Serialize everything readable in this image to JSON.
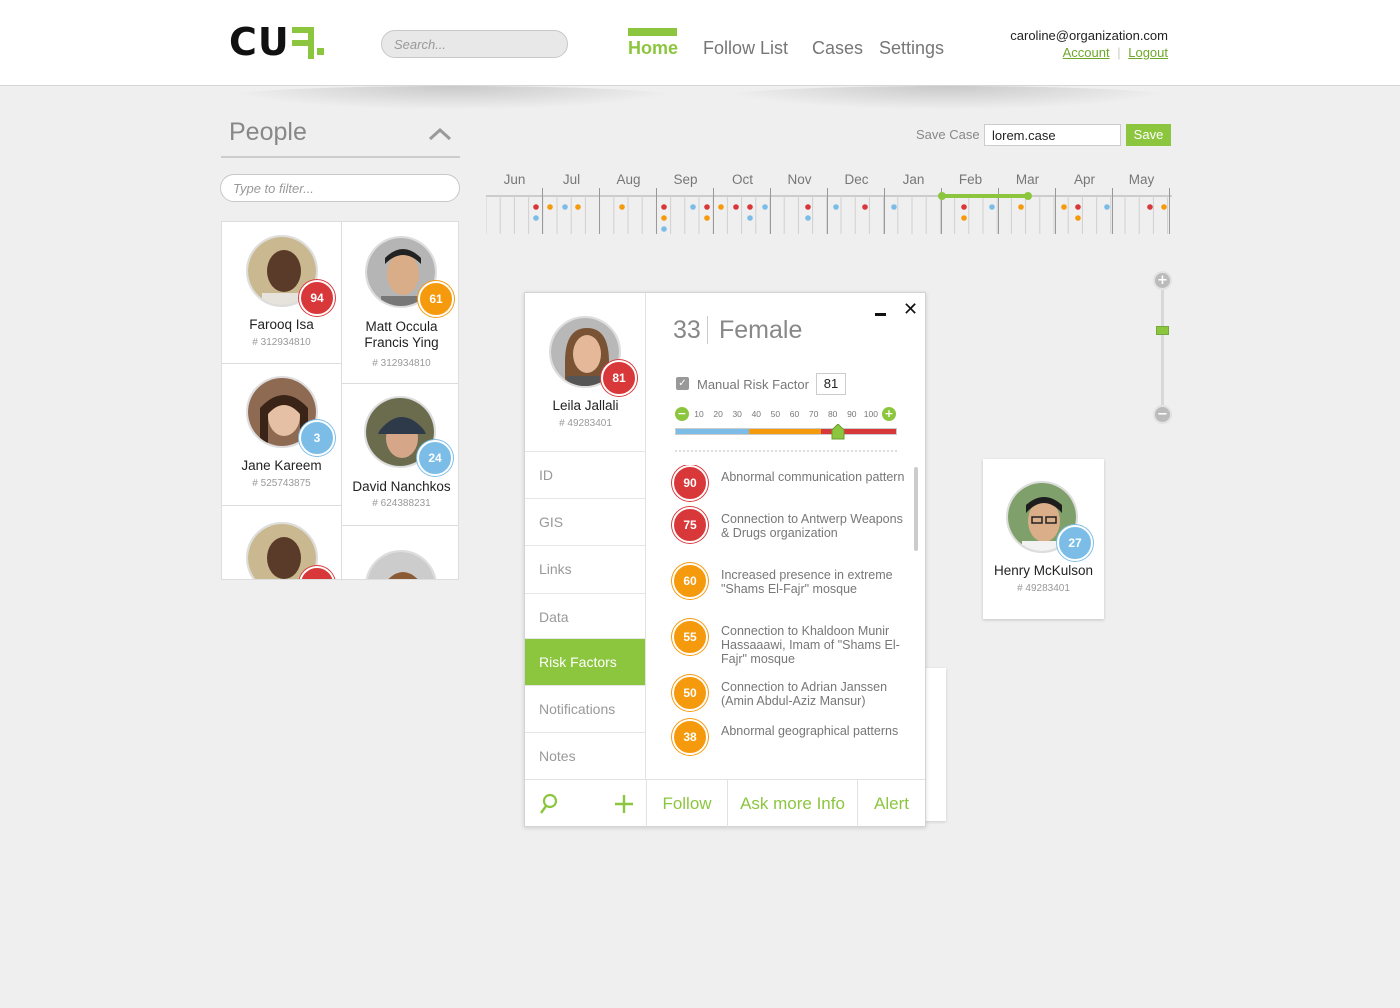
{
  "header": {
    "logo_text": "CU",
    "search_placeholder": "Search...",
    "nav": [
      {
        "label": "Home",
        "active": true
      },
      {
        "label": "Follow List",
        "active": false
      },
      {
        "label": "Cases",
        "active": false
      },
      {
        "label": "Settings",
        "active": false
      }
    ],
    "user_email": "caroline@organization.com",
    "account_label": "Account",
    "logout_label": "Logout",
    "link_separator": "|"
  },
  "people": {
    "title": "People",
    "filter_placeholder": "Type to filter...",
    "cards": [
      {
        "name": "Farooq Isa",
        "id": "# 312934810",
        "score": "94",
        "level": "red"
      },
      {
        "name": "Matt Occula Francis Ying",
        "id": "# 312934810",
        "score": "61",
        "level": "orange"
      },
      {
        "name": "Jane Kareem",
        "id": "# 525743875",
        "score": "3",
        "level": "blue"
      },
      {
        "name": "David Nanchkos",
        "id": "# 624388231",
        "score": "24",
        "level": "blue"
      }
    ]
  },
  "save_case": {
    "label": "Save Case",
    "value": "lorem.case",
    "button": "Save"
  },
  "timeline": {
    "months": [
      "Jun",
      "Jul",
      "Aug",
      "Sep",
      "Oct",
      "Nov",
      "Dec",
      "Jan",
      "Feb",
      "Mar",
      "Apr",
      "May"
    ]
  },
  "zoom": {
    "plus": "+",
    "minus": "−"
  },
  "henry": {
    "name": "Henry McKulson",
    "id": "# 49283401",
    "score": "27"
  },
  "dialog": {
    "person": {
      "name": "Leila Jallali",
      "id": "# 49283401",
      "score": "81"
    },
    "age": "33",
    "gender": "Female",
    "close_glyph": "✕",
    "tabs": [
      "ID",
      "GIS",
      "Links",
      "Data",
      "Risk Factors",
      "Notifications",
      "Notes"
    ],
    "active_tab": "Risk Factors",
    "manual_risk": {
      "checked": true,
      "label": "Manual Risk Factor",
      "value": "81"
    },
    "scale": [
      "10",
      "20",
      "30",
      "40",
      "50",
      "60",
      "70",
      "80",
      "90",
      "100"
    ],
    "scale_minus": "−",
    "scale_plus": "+",
    "risk_factors": [
      {
        "score": "90",
        "level": "red",
        "text": "Abnormal communication pattern"
      },
      {
        "score": "75",
        "level": "red",
        "text": "Connection to Antwerp Weapons & Drugs organization"
      },
      {
        "score": "60",
        "level": "orange",
        "text": "Increased presence in extreme \"Shams El-Fajr\" mosque"
      },
      {
        "score": "55",
        "level": "orange",
        "text": "Connection to Khaldoon Munir Hassaaawi, Imam of \"Shams El-Fajr\" mosque"
      },
      {
        "score": "50",
        "level": "orange",
        "text": "Connection to Adrian Janssen (Amin Abdul-Aziz Mansur)"
      },
      {
        "score": "38",
        "level": "orange",
        "text": "Abnormal geographical patterns"
      }
    ],
    "footer": {
      "follow": "Follow",
      "ask": "Ask more Info",
      "alert": "Alert"
    }
  },
  "colors": {
    "accent": "#8cc63f",
    "red": "#d9383a",
    "orange": "#f59a0d",
    "blue": "#7cbde8"
  }
}
